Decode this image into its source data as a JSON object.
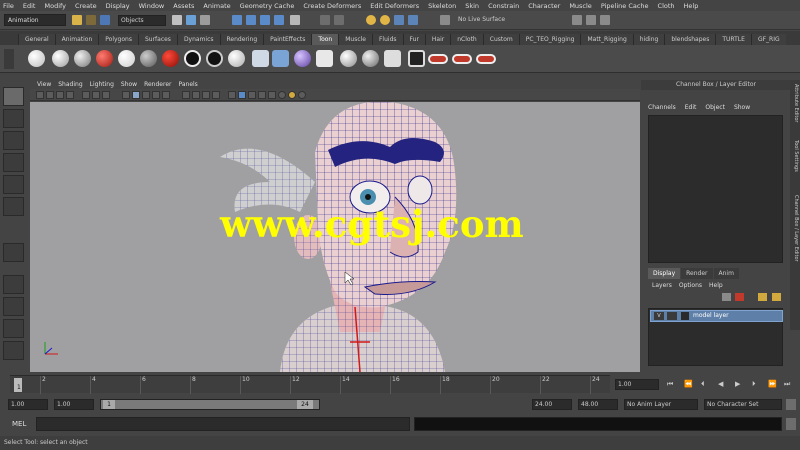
{
  "menubar": {
    "items": [
      "File",
      "Edit",
      "Modify",
      "Create",
      "Display",
      "Window",
      "Assets",
      "Animate",
      "Geometry Cache",
      "Create Deformers",
      "Edit Deformers",
      "Skeleton",
      "Skin",
      "Constrain",
      "Character",
      "Muscle",
      "Pipeline Cache",
      "Cloth",
      "Help"
    ]
  },
  "status": {
    "mode": "Animation",
    "objects_label": "Objects",
    "no_live_surface": "No Live Surface"
  },
  "shelf_tabs": [
    "General",
    "Animation",
    "Polygons",
    "Surfaces",
    "Dynamics",
    "Rendering",
    "PaintEffects",
    "Toon",
    "Muscle",
    "Fluids",
    "Fur",
    "Hair",
    "nCloth",
    "Custom",
    "PC_TEO_Rigging",
    "Matt_Rigging",
    "hiding",
    "blendshapes",
    "TURTLE",
    "GF_RIG"
  ],
  "shelf_active_index": 7,
  "shelf_colors": [
    "#ffffff",
    "#e6e6e6",
    "#bdbdbd",
    "#d22a1e",
    "#efefef",
    "#8c8c8c",
    "#111111",
    "#111111",
    "#ffffff"
  ],
  "panel_menu": [
    "View",
    "Shading",
    "Lighting",
    "Show",
    "Renderer",
    "Panels"
  ],
  "watermark": "www.cgtsj.com",
  "channel_box": {
    "title": "Channel Box / Layer Editor",
    "menu": [
      "Channels",
      "Edit",
      "Object",
      "Show"
    ]
  },
  "side_tabs": [
    "Attribute Editor",
    "Tool Settings",
    "Channel Box / Layer Editor"
  ],
  "layers": {
    "tabs": [
      "Display",
      "Render",
      "Anim"
    ],
    "active_tab": 0,
    "menu": [
      "Layers",
      "Options",
      "Help"
    ],
    "rows": [
      {
        "visible": "V",
        "name": "model layer"
      }
    ]
  },
  "timeline": {
    "ticks": [
      "1",
      "2",
      "4",
      "6",
      "8",
      "10",
      "12",
      "14",
      "16",
      "18",
      "20",
      "22",
      "24"
    ],
    "current_frame": "1.00"
  },
  "range": {
    "start": "1.00",
    "start_inner": "1.00",
    "range_start": "1",
    "range_end": "24",
    "end_inner": "24.00",
    "end": "48.00",
    "anim_layer": "No Anim Layer",
    "character_set": "No Character Set"
  },
  "cmd": {
    "label": "MEL"
  },
  "help_line": "Select Tool: select an object",
  "colors": {
    "accent": "#5d7fa8",
    "viewport_bg": "#a0a0a3",
    "wire": "#1a1a8c",
    "watermark": "#ffff00"
  }
}
